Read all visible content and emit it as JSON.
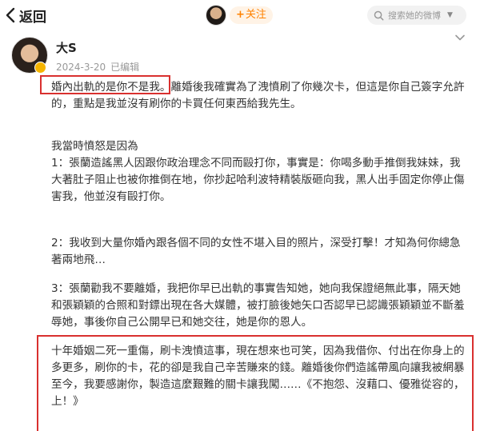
{
  "nav": {
    "back_label": "返回",
    "follow_label": "关注",
    "follow_plus": "+",
    "search_placeholder": "搜索她的微博"
  },
  "post": {
    "author": "大S",
    "date": "2024-3-20",
    "edited": "已编辑",
    "paragraphs": {
      "p1": "婚內出軌的是你不是我。離婚後我確實為了洩憤刷了你幾次卡，但這是你自己簽字允許的，重點是我並沒有刷你的卡買任何東西給我先生。",
      "p2": "我當時憤怒是因為\n1：張蘭造謠黑人因跟你政治理念不同而毆打你，事實是：你喝多動手推倒我妹妹，我大著肚子阻止也被你推倒在地，你抄起哈利波特精裝版砸向我，黑人出手固定你停止傷害我，他並沒有毆打你。",
      "p3": "2：我收到大量你婚內跟各個不同的女性不堪入目的照片，深受打擊！才知為何你總急著兩地飛…",
      "p4": "3：張蘭勸我不要離婚，我把你早已出軌的事實告知她，她向我保證絕無此事，隔天她和張穎穎的合照和對鏢出現在各大媒體，被打臉後她矢口否認早已認識張穎穎並不斷羞辱她，事後你自己公開早已和她交往，她是你的恩人。",
      "p5": "十年婚姻二死一重傷，刷卡洩憤這事，現在想來也可笑，因為我借你、付出在你身上的多更多，刷你的卡，花的卻是我自己辛苦賺來的錢。離婚後你們造謠帶風向讓我被網暴至今，我要感謝你，製造這麼艱難的關卡讓我闖……《不抱怨、沒藉口、優雅從容的，上！》"
    }
  },
  "colors": {
    "accent": "#ff8200",
    "highlight_box": "#d9302f",
    "badge": "#f5b400"
  },
  "icons": {
    "back": "chevron-left-icon",
    "search": "search-icon",
    "collapse": "chevron-down-icon",
    "badge": "verified-badge-icon"
  }
}
